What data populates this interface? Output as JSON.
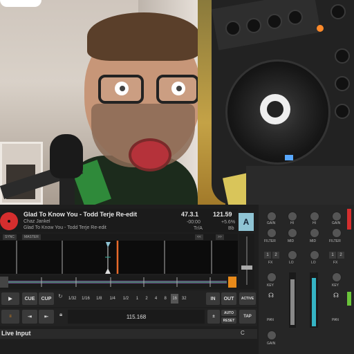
{
  "colors": {
    "accent": "#8fc4d4",
    "playhead": "#e86a2a",
    "vinyl": "#d42e2e",
    "meter": "#35b4c4"
  },
  "deck": {
    "letter": "A",
    "title": "Glad To Know You - Todd Terje Re-edit",
    "artist": "Chaz Jankel",
    "subtitle": "Glad To Know You - Todd Terje Re-edit",
    "time_elapsed": "47.3.1",
    "time_remaining": "-00:00",
    "bpm": "121.59",
    "pitch": "+5.6%",
    "key": "Tr/A",
    "key2": "Bb",
    "sync_label": "SYNC",
    "master_label": "MASTER",
    "grid_left": "<<",
    "grid_right": ">>"
  },
  "transport": {
    "play_icon": "play-icon",
    "cue_label": "CUE",
    "cup_label": "CUP",
    "loop_sizes": [
      "1/32",
      "1/16",
      "1/8",
      "1/4",
      "1/2",
      "1",
      "2",
      "4",
      "8",
      "16",
      "32"
    ],
    "in_label": "IN",
    "out_label": "OUT",
    "active_label": "ACTIVE",
    "tempo_value": "115.168",
    "auto_label": "AUTO",
    "reset_label": "RESET",
    "tap_label": "TAP",
    "tap_sync_label": "TAP"
  },
  "live_input": {
    "label": "Live Input",
    "letter": "C"
  },
  "mixer": {
    "gain_label": "GAIN",
    "hi_label": "HI",
    "mid_label": "MID",
    "lo_label": "LO",
    "filter_label": "FILTER",
    "fx_label": "FX",
    "key_label": "KEY",
    "pan_label": "PAN",
    "fx1": "1",
    "fx2": "2"
  }
}
